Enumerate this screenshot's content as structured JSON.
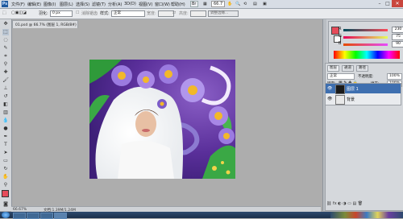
{
  "menubar": {
    "logo": "Ps",
    "items": [
      "文件(F)",
      "编辑(E)",
      "图像(I)",
      "图层(L)",
      "选择(S)",
      "滤镜(T)",
      "分析(A)",
      "3D(D)",
      "视图(V)",
      "窗口(W)",
      "帮助(H)"
    ],
    "zoom": "66.7"
  },
  "options": {
    "feather_label": "羽化:",
    "feather_value": "0 px",
    "antialias_label": "消除锯齿",
    "style_label": "样式:",
    "style_value": "正常",
    "width_label": "宽度:",
    "height_label": "高度:",
    "refine_label": "调整边缘..."
  },
  "document": {
    "tab_title": "01.psd @ 66.7% (图层 1, RGB/8#)",
    "zoom_status": "66.67%",
    "doc_status": "文档:1.39M/1.24M"
  },
  "color_panel": {
    "r_value": "230",
    "g_value": "75",
    "b_value": "90",
    "fg_color": "#e64b5a"
  },
  "layers_panel": {
    "tabs": [
      "图层",
      "通道",
      "路径"
    ],
    "blend_mode": "正常",
    "opacity_label": "不透明度:",
    "opacity_value": "100%",
    "lock_label": "锁定:",
    "fill_label": "填充:",
    "fill_value": "100%",
    "layers": [
      {
        "name": "图层 1",
        "selected": true
      },
      {
        "name": "背景",
        "selected": false
      }
    ]
  }
}
